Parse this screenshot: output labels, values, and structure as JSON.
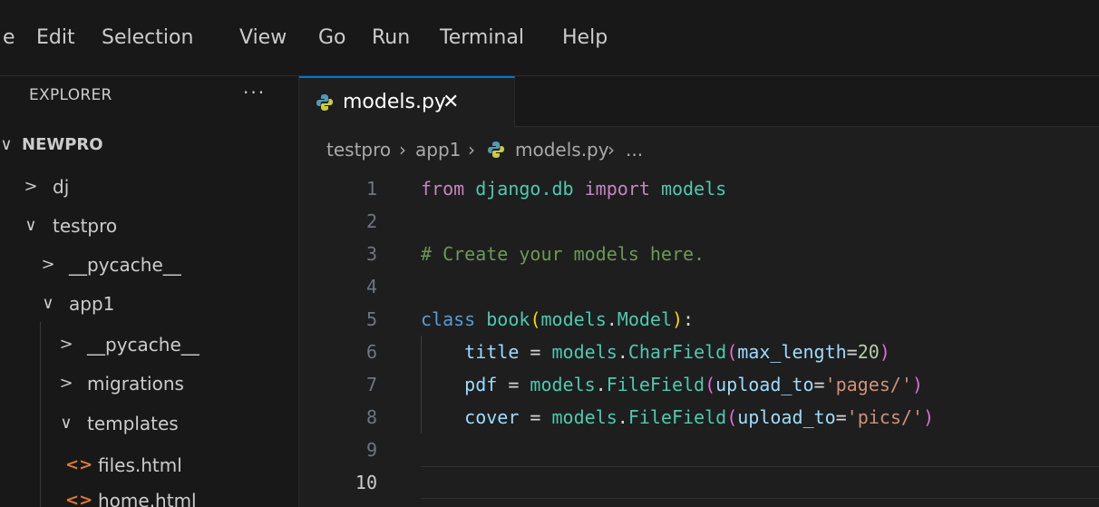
{
  "menu": [
    "e",
    "Edit",
    "Selection",
    "View",
    "Go",
    "Run",
    "Terminal",
    "Help"
  ],
  "sidebar": {
    "title": "EXPLORER",
    "more": "···",
    "root": "NEWPRO",
    "items": [
      {
        "label": "dj"
      },
      {
        "label": "testpro"
      },
      {
        "label": "__pycache__"
      },
      {
        "label": "app1"
      },
      {
        "label": "__pycache__"
      },
      {
        "label": "migrations"
      },
      {
        "label": "templates"
      },
      {
        "label": "files.html",
        "icon": "<>"
      },
      {
        "label": "home.html",
        "icon": "<>"
      }
    ]
  },
  "tab": {
    "label": "models.py",
    "close": "✕"
  },
  "breadcrumb": [
    "testpro",
    "app1",
    "models.py",
    "..."
  ],
  "editor": {
    "active_line": 10,
    "lines": [
      {
        "n": "1",
        "tokens": [
          [
            "kw",
            "from"
          ],
          [
            "op",
            " "
          ],
          [
            "mod",
            "django.db"
          ],
          [
            "op",
            " "
          ],
          [
            "kw",
            "import"
          ],
          [
            "op",
            " "
          ],
          [
            "mod",
            "models"
          ]
        ]
      },
      {
        "n": "2",
        "tokens": []
      },
      {
        "n": "3",
        "tokens": [
          [
            "cm",
            "# Create your models here."
          ]
        ]
      },
      {
        "n": "4",
        "tokens": []
      },
      {
        "n": "5",
        "tokens": [
          [
            "kwb",
            "class"
          ],
          [
            "op",
            " "
          ],
          [
            "cls",
            "book"
          ],
          [
            "p1",
            "("
          ],
          [
            "mod",
            "models"
          ],
          [
            "op",
            "."
          ],
          [
            "cls",
            "Model"
          ],
          [
            "p1",
            ")"
          ],
          [
            "op",
            ":"
          ]
        ]
      },
      {
        "n": "6",
        "tokens": [
          [
            "op",
            "    "
          ],
          [
            "var",
            "title"
          ],
          [
            "op",
            " = "
          ],
          [
            "mod",
            "models"
          ],
          [
            "op",
            "."
          ],
          [
            "fn",
            "CharField"
          ],
          [
            "p2",
            "("
          ],
          [
            "var",
            "max_length"
          ],
          [
            "op",
            "="
          ],
          [
            "num",
            "20"
          ],
          [
            "p2",
            ")"
          ]
        ]
      },
      {
        "n": "7",
        "tokens": [
          [
            "op",
            "    "
          ],
          [
            "var",
            "pdf"
          ],
          [
            "op",
            " = "
          ],
          [
            "mod",
            "models"
          ],
          [
            "op",
            "."
          ],
          [
            "fn",
            "FileField"
          ],
          [
            "p2",
            "("
          ],
          [
            "var",
            "upload_to"
          ],
          [
            "op",
            "="
          ],
          [
            "str",
            "'pages/'"
          ],
          [
            "p2",
            ")"
          ]
        ]
      },
      {
        "n": "8",
        "tokens": [
          [
            "op",
            "    "
          ],
          [
            "var",
            "cover"
          ],
          [
            "op",
            " = "
          ],
          [
            "mod",
            "models"
          ],
          [
            "op",
            "."
          ],
          [
            "fn",
            "FileField"
          ],
          [
            "p2",
            "("
          ],
          [
            "var",
            "upload_to"
          ],
          [
            "op",
            "="
          ],
          [
            "str",
            "'pics/'"
          ],
          [
            "p2",
            ")"
          ]
        ]
      },
      {
        "n": "9",
        "tokens": []
      },
      {
        "n": "10",
        "tokens": []
      }
    ]
  }
}
